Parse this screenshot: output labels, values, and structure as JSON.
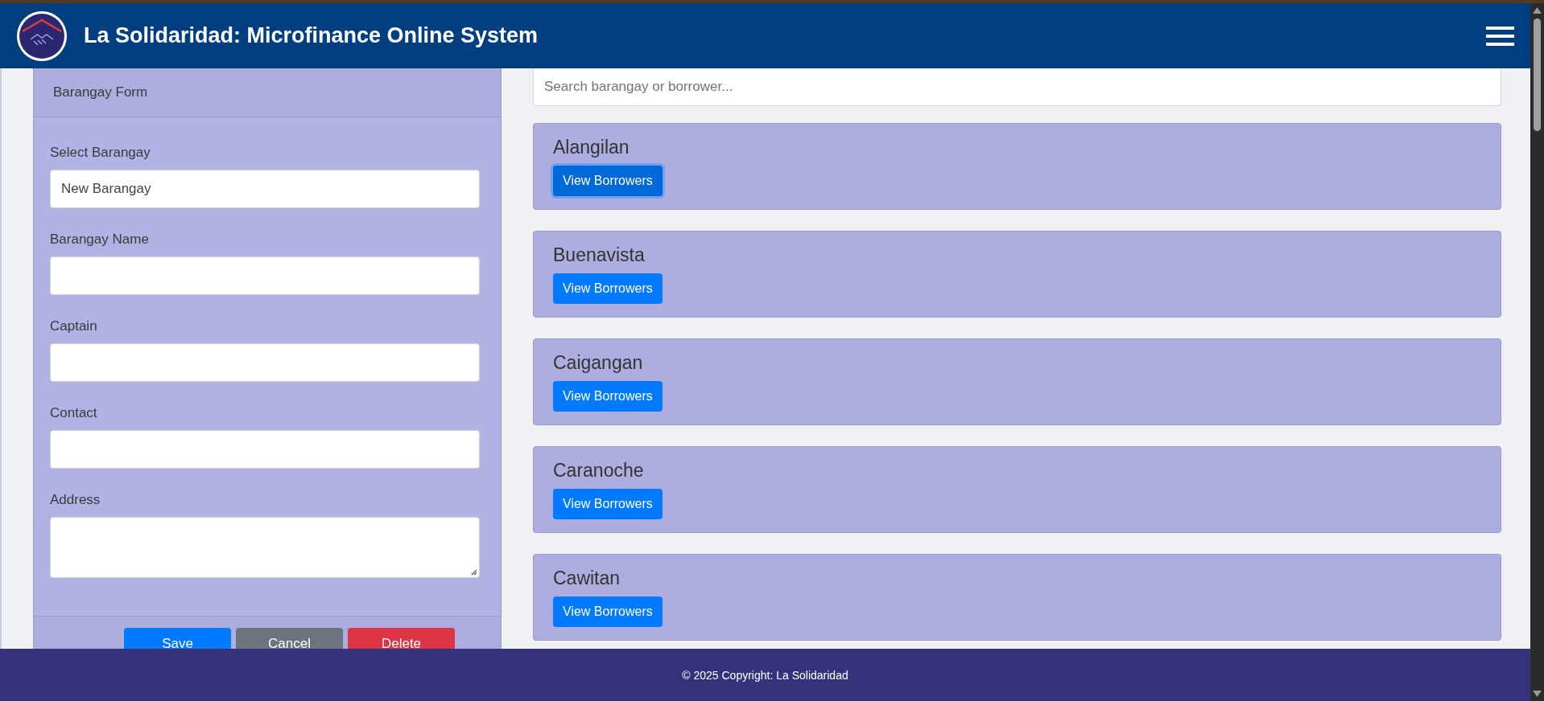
{
  "header": {
    "title": "La Solidaridad: Microfinance Online System"
  },
  "form": {
    "title": "Barangay Form",
    "fields": [
      {
        "label": "Select Barangay",
        "kind": "select",
        "value": "New Barangay"
      },
      {
        "label": "Barangay Name",
        "kind": "text"
      },
      {
        "label": "Captain",
        "kind": "text"
      },
      {
        "label": "Contact",
        "kind": "text"
      },
      {
        "label": "Address",
        "kind": "textarea"
      }
    ],
    "buttons": [
      {
        "label": "Save",
        "kind": "primary"
      },
      {
        "label": "Cancel",
        "kind": "secondary"
      },
      {
        "label": "Delete",
        "kind": "danger"
      }
    ]
  },
  "search": {
    "placeholder": "Search barangay or borrower..."
  },
  "barangays": [
    {
      "name": "Alangilan",
      "button": "View Borrowers",
      "focused": true
    },
    {
      "name": "Buenavista",
      "button": "View Borrowers",
      "focused": false
    },
    {
      "name": "Caigangan",
      "button": "View Borrowers",
      "focused": false
    },
    {
      "name": "Caranoche",
      "button": "View Borrowers",
      "focused": false
    },
    {
      "name": "Cawitan",
      "button": "View Borrowers",
      "focused": false
    }
  ],
  "footer": {
    "text": "© 2025 Copyright: La Solidaridad"
  }
}
